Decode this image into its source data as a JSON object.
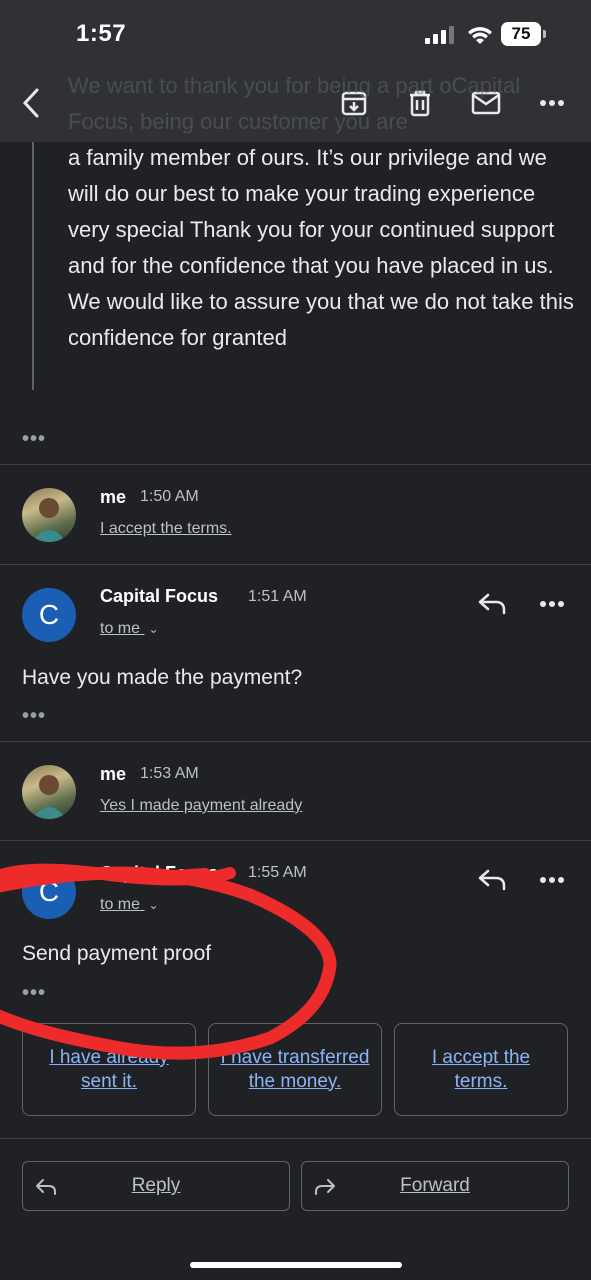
{
  "status_bar": {
    "time": "1:57",
    "battery": "75"
  },
  "toolbar": {
    "back_icon": "back-arrow-icon",
    "archive_icon": "archive-icon",
    "delete_icon": "trash-icon",
    "mark_unread_icon": "mail-icon",
    "more_icon": "more-horizontal-icon"
  },
  "quoted_message": {
    "ghost_text": "We want to thank you for being a part oCapital Focus, being our customer you are",
    "text": "a family member of ours. It’s our privilege and we will do our best to make your trading experience very special Thank you for your continued support and for the confidence that you have placed in us. We would like to assure you that we do not take this confidence for granted",
    "more_dots": "•••"
  },
  "messages": [
    {
      "sender": "me",
      "time": "1:50 AM",
      "snippet": "I accept the terms."
    },
    {
      "sender": "Capital Focus",
      "avatar_letter": "C",
      "time": "1:51 AM",
      "recipient": "to me",
      "body": "Have you made the payment?",
      "more_dots": "•••"
    },
    {
      "sender": "me",
      "time": "1:53 AM",
      "snippet": "Yes I made payment already"
    },
    {
      "sender": "Capital Focus",
      "avatar_letter": "C",
      "time": "1:55 AM",
      "recipient": "to me",
      "body": "Send payment proof",
      "more_dots": "•••"
    }
  ],
  "smart_replies": [
    "I have already sent it.",
    "I have transferred the money.",
    "I accept the terms."
  ],
  "actions": {
    "reply": "Reply",
    "forward": "Forward"
  },
  "colors": {
    "background": "#202124",
    "toolbar": "#303134",
    "avatar_blue": "#1a5fb4",
    "link": "#8ab4f8",
    "annotation_red": "#ee2b2b"
  }
}
